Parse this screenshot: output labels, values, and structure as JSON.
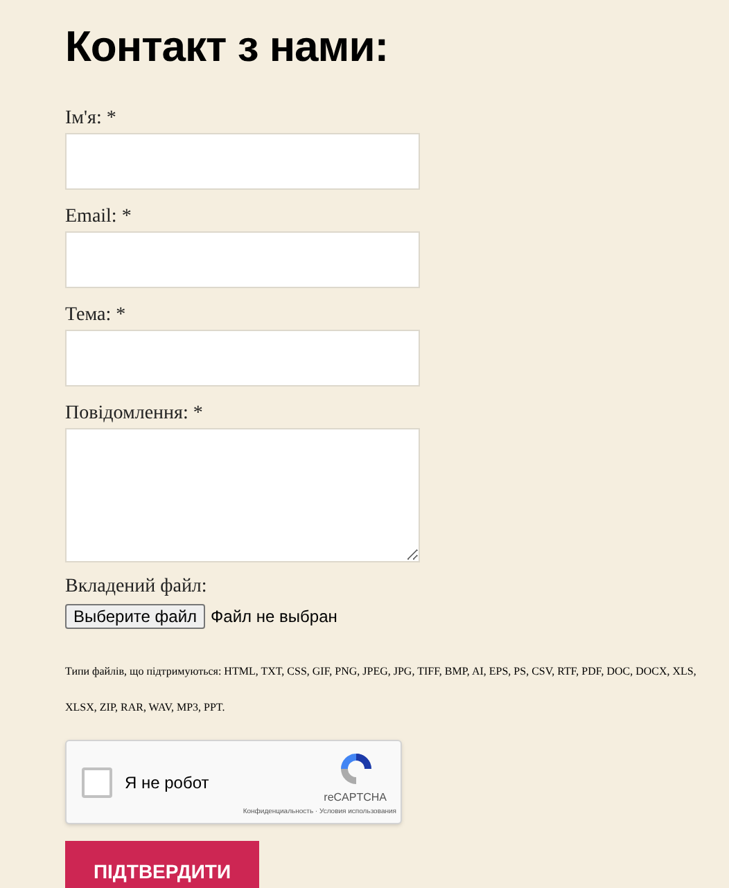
{
  "title": "Контакт з нами:",
  "fields": [
    {
      "label": "Ім'я: *",
      "kind": "input"
    },
    {
      "label": "Email: *",
      "kind": "input"
    },
    {
      "label": "Тема: *",
      "kind": "input"
    },
    {
      "label": "Повідомлення: *",
      "kind": "textarea"
    }
  ],
  "attachment": {
    "label": "Вкладений файл:",
    "button": "Выберите файл",
    "status": "Файл не выбран"
  },
  "note": "Типи файлів, що підтримуються: HTML, TXT, CSS, GIF, PNG, JPEG, JPG, TIFF, BMP, AI, EPS, PS, CSV, RTF, PDF, DOC, DOCX, XLS, XLSX, ZIP, RAR, WAV, MP3, PPT.",
  "captcha": {
    "checked": false,
    "label": "Я не робот",
    "brand": "reCAPTCHA",
    "links": "Конфиденциальность · Условия использования"
  },
  "submit": "ПІДТВЕРДИТИ"
}
